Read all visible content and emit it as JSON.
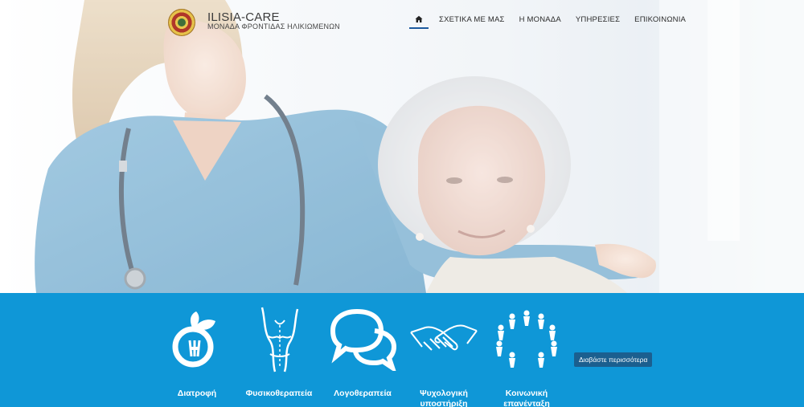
{
  "brand": {
    "title": "ILISIA-CARE",
    "subtitle": "ΜΟΝΑΔΑ ΦΡΟΝΤΙΔΑΣ ΗΛΙΚΙΩΜΕΝΩΝ"
  },
  "nav": {
    "home_icon": "home-icon",
    "items": [
      {
        "label": "ΣΧΕΤΙΚΑ ΜΕ ΜΑΣ"
      },
      {
        "label": "Η ΜΟΝΑΔΑ"
      },
      {
        "label": "ΥΠΗΡΕΣΙΕΣ"
      },
      {
        "label": "ΕΠΙΚΟΙΝΩΝΙΑ"
      }
    ],
    "active": "home"
  },
  "services": [
    {
      "label": "Διατροφή",
      "icon": "nutrition-icon"
    },
    {
      "label": "Φυσικοθεραπεία",
      "icon": "physiotherapy-icon"
    },
    {
      "label": "Λογοθεραπεία",
      "icon": "speech-bubbles-icon"
    },
    {
      "label": "Ψυχολογική υποστήριξη",
      "icon": "handshake-icon"
    },
    {
      "label": "Κοινωνική επανένταξη",
      "icon": "community-circle-icon"
    }
  ],
  "read_more_label": "Διαβάστε περισσότερα",
  "colors": {
    "band": "#0f97d7",
    "nav_active": "#1d5a9e",
    "button": "#1b5f8f"
  }
}
